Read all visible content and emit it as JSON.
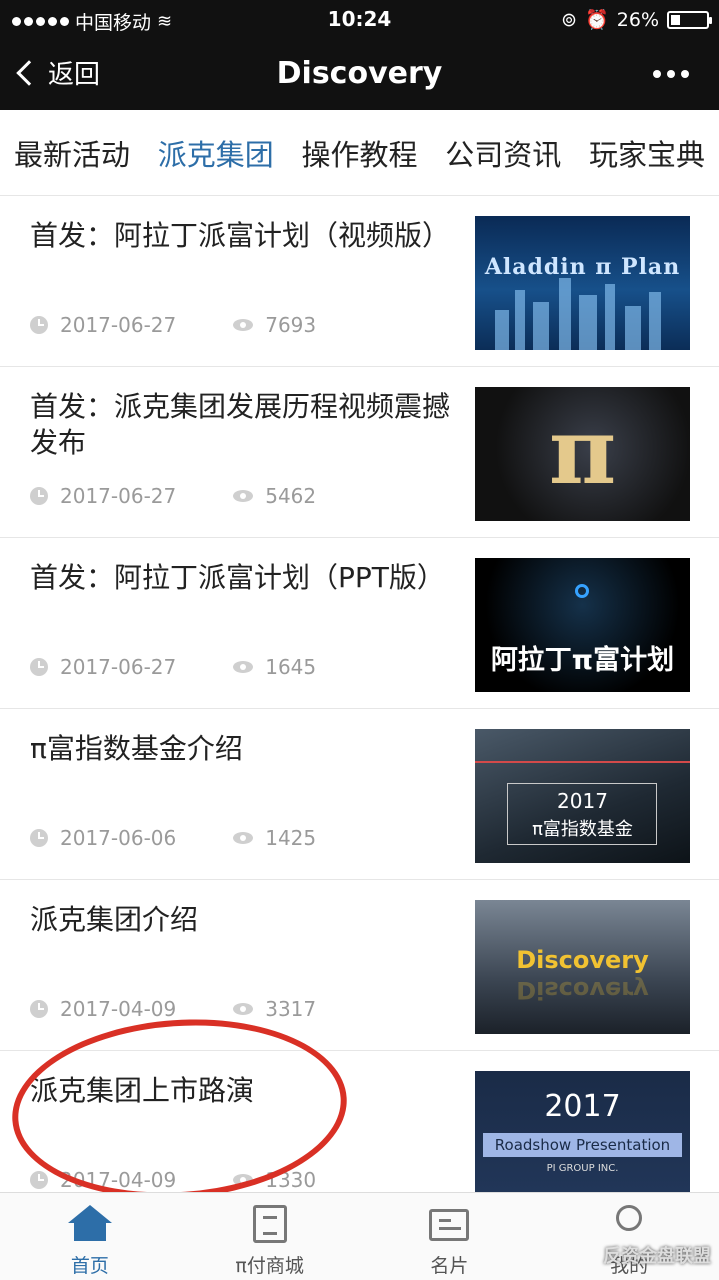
{
  "status": {
    "carrier": "中国移动",
    "time": "10:24",
    "battery": "26%",
    "battery_level": 0.26
  },
  "nav": {
    "back_label": "返回",
    "title": "Discovery"
  },
  "tabs": [
    "最新活动",
    "派克集团",
    "操作教程",
    "公司资讯",
    "玩家宝典"
  ],
  "active_tab": 1,
  "items": [
    {
      "title": "首发：阿拉丁派富计划（视频版）",
      "date": "2017-06-27",
      "views": "7693",
      "thumb_text": "Aladdin π Plan"
    },
    {
      "title": "首发：派克集团发展历程视频震撼发布",
      "date": "2017-06-27",
      "views": "5462",
      "thumb_text": "π"
    },
    {
      "title": "首发：阿拉丁派富计划（PPT版）",
      "date": "2017-06-27",
      "views": "1645",
      "thumb_text": "阿拉丁π富计划"
    },
    {
      "title": "π富指数基金介绍",
      "date": "2017-06-06",
      "views": "1425",
      "thumb_line1": "2017",
      "thumb_line2": "π富指数基金"
    },
    {
      "title": "派克集团介绍",
      "date": "2017-04-09",
      "views": "3317",
      "thumb_text": "Discovery"
    },
    {
      "title": "派克集团上市路演",
      "date": "2017-04-09",
      "views": "1330",
      "thumb_year": "2017",
      "thumb_band": "Roadshow Presentation",
      "thumb_group": "PI GROUP INC."
    }
  ],
  "tabbar": [
    {
      "label": "首页",
      "icon": "home-icon"
    },
    {
      "label": "π付商城",
      "icon": "shop-icon"
    },
    {
      "label": "名片",
      "icon": "card-icon"
    },
    {
      "label": "我的",
      "icon": "profile-icon"
    }
  ],
  "watermark": "反资金盘联盟",
  "colors": {
    "accent": "#2d6ea8",
    "annotation": "#d93025",
    "header_bg": "#111111"
  }
}
